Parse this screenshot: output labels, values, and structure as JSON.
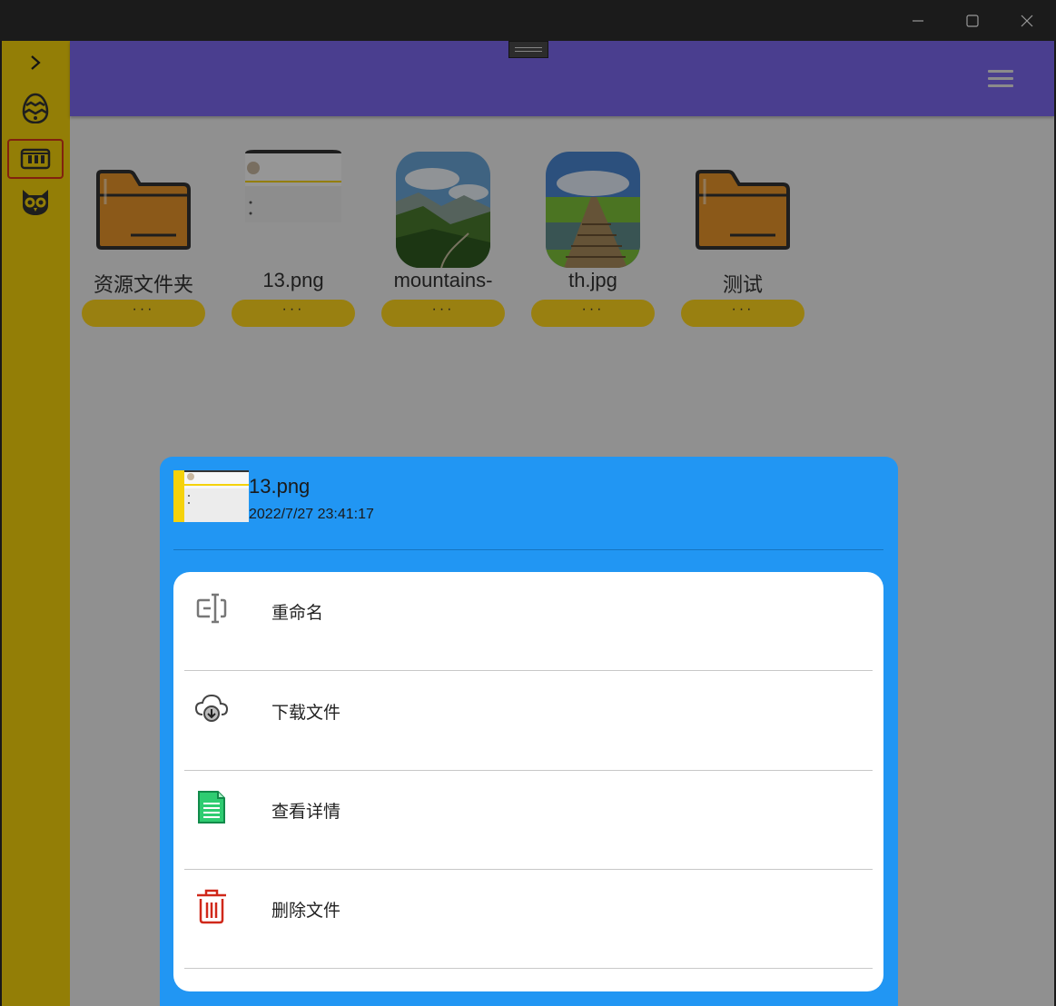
{
  "window": {
    "controls": [
      "minimize",
      "maximize",
      "close"
    ]
  },
  "sidebar": {
    "items": [
      {
        "icon": "chevron-right-icon"
      },
      {
        "icon": "easter-egg-icon"
      },
      {
        "icon": "film-strip-icon",
        "active": true
      },
      {
        "icon": "owl-icon"
      }
    ]
  },
  "header": {
    "menu_icon": "hamburger-menu-icon"
  },
  "files": [
    {
      "name": "资源文件夹",
      "type": "folder",
      "more": "···"
    },
    {
      "name": "13.png",
      "type": "image",
      "more": "···"
    },
    {
      "name": "mountains-",
      "type": "image",
      "more": "···"
    },
    {
      "name": "th.jpg",
      "type": "image",
      "more": "···"
    },
    {
      "name": "测试",
      "type": "folder",
      "more": "···"
    }
  ],
  "sheet": {
    "title": "13.png",
    "date": "2022/7/27 23:41:17",
    "actions": [
      {
        "label": "重命名",
        "icon": "rename-icon"
      },
      {
        "label": "下载文件",
        "icon": "cloud-download-icon"
      },
      {
        "label": "查看详情",
        "icon": "document-details-icon"
      },
      {
        "label": "删除文件",
        "icon": "trash-icon"
      }
    ]
  },
  "colors": {
    "sidebar": "#f5d20b",
    "header": "#7c68ef",
    "sheet": "#2196f3",
    "folder": "#e8952a",
    "more_button": "#ffd51d",
    "delete": "#d0281a",
    "details": "#2ecc71"
  }
}
